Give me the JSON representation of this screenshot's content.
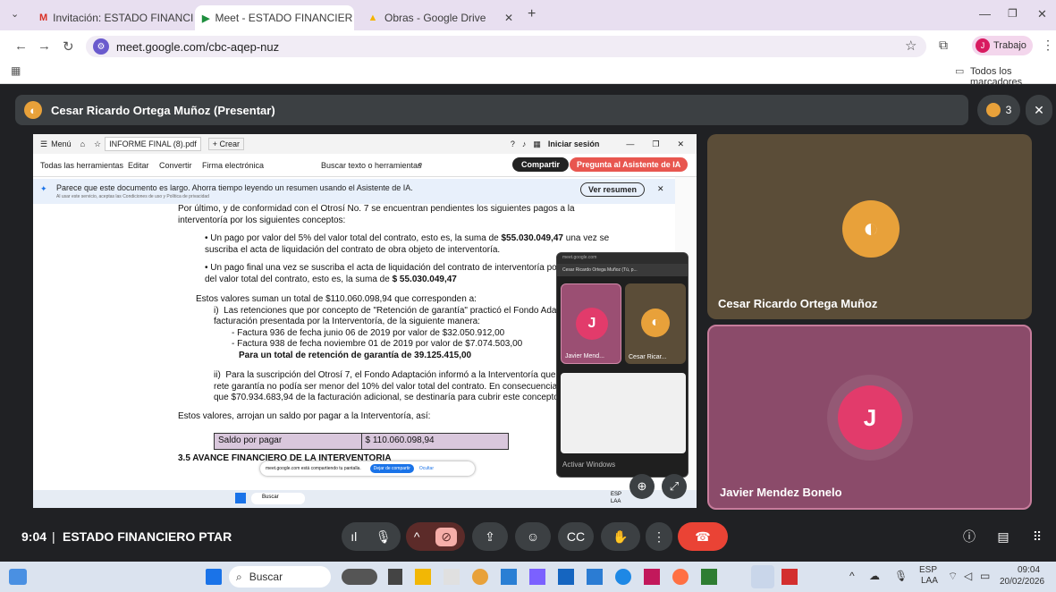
{
  "browser": {
    "tabs": [
      {
        "label": "Invitación: ESTADO FINANCIER",
        "icon": "gmail-icon"
      },
      {
        "label": "Meet - ESTADO FINANCIER",
        "icon": "meet-icon"
      },
      {
        "label": "Obras - Google Drive",
        "icon": "drive-icon"
      }
    ],
    "new_tab": "+",
    "url": "meet.google.com/cbc-aqep-nuz",
    "profile_label": "Trabajo",
    "profile_initial": "J",
    "bookmarks_label": "Todos los marcadores"
  },
  "meet": {
    "presenter_label": "Cesar Ricardo Ortega Muñoz (Presentar)",
    "participant_count": "3",
    "time": "9:04",
    "meeting_title": "ESTADO FINANCIERO PTAR",
    "separator": "|"
  },
  "shared_screen": {
    "menu_label": "Menú",
    "tab_label": "INFORME FINAL (8).pdf",
    "create_label": "+ Crear",
    "signin_label": "Iniciar sesión",
    "toolbar": [
      "Todas las herramientas",
      "Editar",
      "Convertir",
      "Firma electrónica"
    ],
    "search_tools": "Buscar texto o herramientas",
    "share_btn": "Compartir",
    "ai_btn": "Pregunta al Asistente de IA",
    "banner_text": "Parece que este documento es largo. Ahorra tiempo leyendo un resumen usando el Asistente de IA.",
    "banner_small": "Al usar este servicio, aceptas las Condiciones de uso y Política de privacidad",
    "summary_btn": "Ver resumen",
    "doc": {
      "p1": "Por último, y de conformidad con el Otrosí No. 7 se encuentran pendientes los siguientes pagos a la interventoría por los siguientes conceptos:",
      "b1": "Un pago por valor del 5% del valor total del contrato, esto es, la suma de",
      "b1_bold": "$55.030.049,47",
      "b1_rest": "una vez se suscriba el acta de liquidación del contrato de obra objeto de interventoría.",
      "b2": "Un pago final una vez se suscriba el acta de liquidación del contrato de interventoría por valor del 5% del valor total del contrato, esto es, la suma de",
      "b2_bold": "$ 55.030.049,47",
      "p2": "Estos valores suman un total de $110.060.098,94 que corresponden a:",
      "i_label": "i)",
      "i_text": "Las retenciones que por concepto de \"Retención de garantía\" practicó el Fondo Adaptación, a la facturación presentada por la Interventoría, de la siguiente manera:",
      "f1": "Factura 936 de fecha junio 06 de 2019 por valor de $32.050.912,00",
      "f2": "Factura 938 de fecha noviembre 01 de 2019 por valor de $7.074.503,00",
      "f_total": "Para un total de retención de garantía de 39.125.415,00",
      "ii_label": "ii)",
      "ii_text": "Para la suscripción del Otrosí 7, el Fondo Adaptación informó a la Interventoría que el valor de la rete garantía no podía ser menor del 10% del valor total del contrato. En consecuencia, se dispuso que $70.934.683,94 de la facturación adicional, se destinaría para cubrir este concepto.",
      "p3": "Estos valores, arrojan un saldo por pagar a la Interventoría, así:",
      "table_label": "Saldo por pagar",
      "table_value": "$ 110.060.098,94",
      "heading": "3.5 AVANCE FINANCIERO DE LA INTERVENTORIA"
    },
    "share_notice": "meet.google.com está compartiendo tu pantalla.",
    "stop_share": "Dejar de compartir",
    "hide": "Ocultar",
    "win_search": "Buscar",
    "win_lang": "ESP",
    "win_lang2": "LAA",
    "activate": "Activar Windows"
  },
  "pip": {
    "url": "meet.google.com",
    "title": "Cesar Ricardo Ortega Muñoz (Tú, p...",
    "tile1_name": "Javier Mend...",
    "tile1_initial": "J",
    "tile2_name": "Cesar Ricar..."
  },
  "tiles": [
    {
      "name": "Cesar Ricardo Ortega Muñoz"
    },
    {
      "name": "Javier Mendez Bonelo",
      "initial": "J"
    }
  ],
  "taskbar": {
    "search": "Buscar",
    "lang": "ESP",
    "lang2": "LAA",
    "time": "09:04",
    "date": "20/02/2026"
  },
  "colors": {
    "end_call": "#ea4335",
    "accent": "#1a73e8",
    "tile_highlight": "#c77d9c"
  }
}
